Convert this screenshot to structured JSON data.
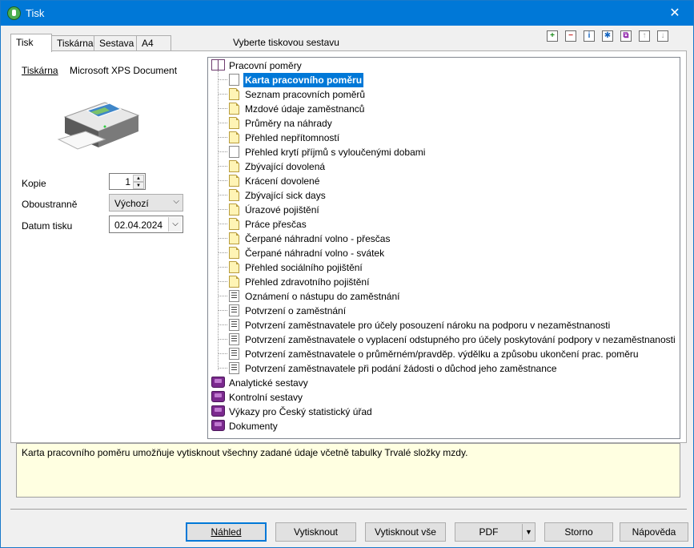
{
  "window": {
    "title": "Tisk",
    "close_glyph": "✕"
  },
  "tabs": [
    {
      "label": "Tisk",
      "active": true
    },
    {
      "label": "Tiskárna",
      "active": false
    },
    {
      "label": "Sestava",
      "active": false
    },
    {
      "label": "A4",
      "active": false
    }
  ],
  "prompt": "Vyberte tiskovou sestavu",
  "toolbar": [
    {
      "icon": "add-icon",
      "glyph": "+",
      "color": "#1a8a1a"
    },
    {
      "icon": "remove-icon",
      "glyph": "−",
      "color": "#c62828"
    },
    {
      "icon": "info-icon",
      "glyph": "i",
      "color": "#1565c0"
    },
    {
      "icon": "star-icon",
      "glyph": "✱",
      "color": "#1565c0"
    },
    {
      "icon": "copy-icon",
      "glyph": "⧉",
      "color": "#8e24aa"
    },
    {
      "icon": "move-up-icon",
      "glyph": "↑",
      "color": "#9e9e9e"
    },
    {
      "icon": "move-down-icon",
      "glyph": "↓",
      "color": "#9e9e9e"
    }
  ],
  "printer": {
    "link_label": "Tiskárna",
    "name": "Microsoft XPS Document"
  },
  "form": {
    "copies_label": "Kopie",
    "copies_value": "1",
    "duplex_label": "Oboustranně",
    "duplex_value": "Výchozí",
    "date_label": "Datum tisku",
    "date_value": "02.04.2024"
  },
  "tree": {
    "root": "Pracovní poměry",
    "items": [
      {
        "label": "Karta pracovního poměru",
        "icon": "white",
        "selected": true
      },
      {
        "label": "Seznam pracovních poměrů",
        "icon": "yellow"
      },
      {
        "label": "Mzdové údaje zaměstnanců",
        "icon": "yellow"
      },
      {
        "label": "Průměry na náhrady",
        "icon": "yellow"
      },
      {
        "label": "Přehled nepřítomností",
        "icon": "yellow"
      },
      {
        "label": "Přehled krytí příjmů s vyloučenými dobami",
        "icon": "white"
      },
      {
        "label": "Zbývající dovolená",
        "icon": "yellow"
      },
      {
        "label": "Krácení dovolené",
        "icon": "yellow"
      },
      {
        "label": "Zbývající sick days",
        "icon": "yellow"
      },
      {
        "label": "Úrazové pojištění",
        "icon": "yellow"
      },
      {
        "label": "Práce přesčas",
        "icon": "yellow"
      },
      {
        "label": "Čerpané náhradní volno - přesčas",
        "icon": "yellow"
      },
      {
        "label": "Čerpané náhradní volno - svátek",
        "icon": "yellow"
      },
      {
        "label": "Přehled sociálního pojištění",
        "icon": "yellow"
      },
      {
        "label": "Přehled zdravotního pojištění",
        "icon": "yellow"
      },
      {
        "label": "Oznámení o nástupu do zaměstnání",
        "icon": "lines"
      },
      {
        "label": "Potvrzení o zaměstnání",
        "icon": "lines"
      },
      {
        "label": "Potvrzení zaměstnavatele pro účely posouzení nároku na podporu v nezaměstnanosti",
        "icon": "lines"
      },
      {
        "label": "Potvrzení zaměstnavatele o vyplacení odstupného pro účely poskytování podpory v nezaměstnanosti",
        "icon": "lines"
      },
      {
        "label": "Potvrzení zaměstnavatele o průměrném/pravděp. výdělku a způsobu ukončení prac. poměru",
        "icon": "lines"
      },
      {
        "label": "Potvrzení zaměstnavatele při podání žádosti o důchod jeho zaměstnance",
        "icon": "lines"
      }
    ],
    "groups": [
      "Analytické sestavy",
      "Kontrolní sestavy",
      "Výkazy pro Český statistický úřad",
      "Dokumenty"
    ]
  },
  "description": "Karta pracovního poměru umožňuje vytisknout všechny zadané údaje včetně tabulky Trvalé složky mzdy.",
  "buttons": {
    "preview": "Náhled",
    "print": "Vytisknout",
    "print_all": "Vytisknout vše",
    "pdf": "PDF",
    "cancel": "Storno",
    "help": "Nápověda"
  }
}
